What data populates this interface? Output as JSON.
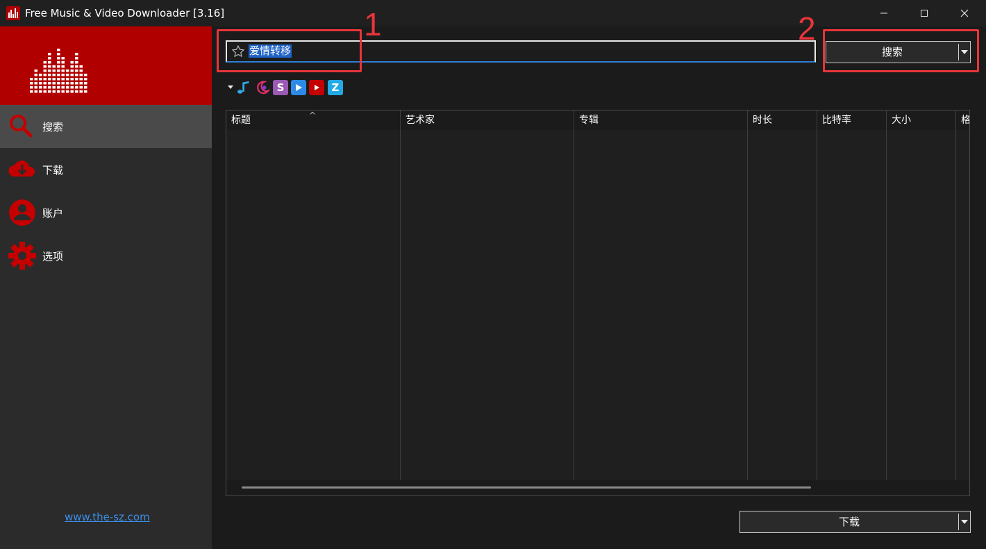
{
  "window": {
    "title": "Free Music & Video Downloader [3.16]"
  },
  "sidebar": {
    "items": [
      {
        "label": "搜索",
        "icon": "search-icon",
        "active": true
      },
      {
        "label": "下载",
        "icon": "cloud-download-icon",
        "active": false
      },
      {
        "label": "账户",
        "icon": "account-icon",
        "active": false
      },
      {
        "label": "选项",
        "icon": "gear-icon",
        "active": false
      }
    ],
    "link": "www.the-sz.com"
  },
  "search": {
    "value": "爱情转移",
    "button_label": "搜索"
  },
  "sources": [
    "music-note-icon",
    "moon-icon",
    "s-icon",
    "play-icon",
    "youtube-icon",
    "z-icon"
  ],
  "table": {
    "columns": [
      "标题",
      "艺术家",
      "专辑",
      "时长",
      "比特率",
      "大小",
      "格"
    ],
    "rows": []
  },
  "footer": {
    "download_label": "下载"
  },
  "annotations": {
    "first": "1",
    "second": "2"
  },
  "colors": {
    "accent": "#b00000",
    "highlight": "#e8353a",
    "selection": "#1f63c6",
    "link": "#3b8fe8"
  }
}
